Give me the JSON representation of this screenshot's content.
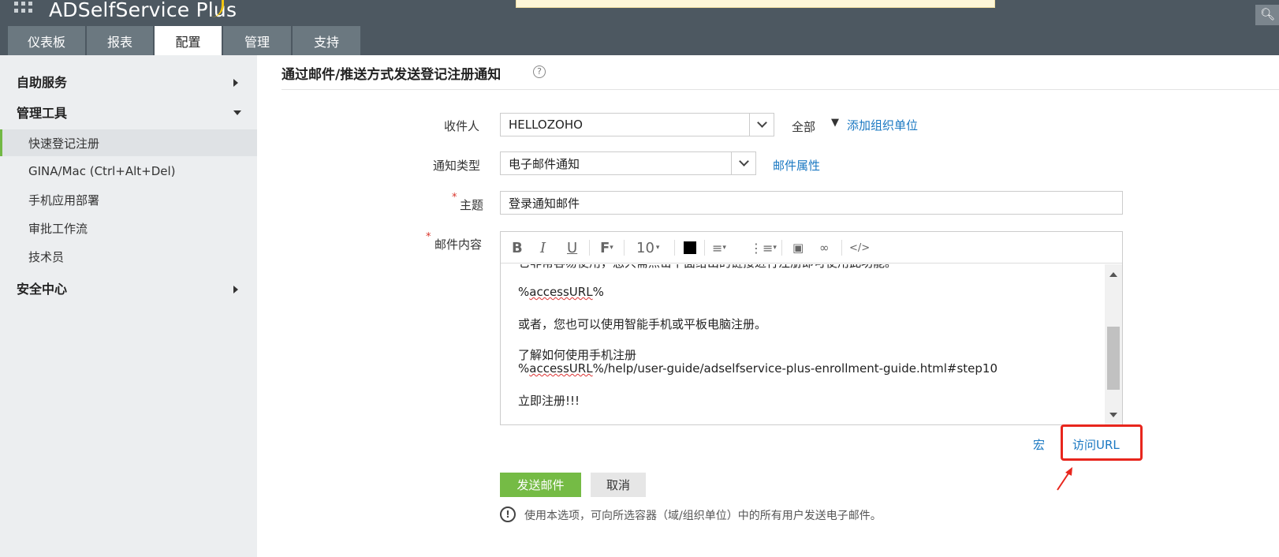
{
  "header": {
    "logo": "ADSelfService Plus",
    "tabs": [
      {
        "label": "仪表板"
      },
      {
        "label": "报表"
      },
      {
        "label": "配置"
      },
      {
        "label": "管理"
      },
      {
        "label": "支持"
      }
    ],
    "active_tab": "配置",
    "search_icon": "search-icon"
  },
  "sidebar": {
    "sections": [
      {
        "label": "自助服务",
        "expanded": false
      },
      {
        "label": "管理工具",
        "expanded": true
      },
      {
        "label": "安全中心",
        "expanded": false
      }
    ],
    "items": [
      {
        "label": "快速登记注册",
        "active": true
      },
      {
        "label": "GINA/Mac (Ctrl+Alt+Del)"
      },
      {
        "label": "手机应用部署"
      },
      {
        "label": "审批工作流"
      },
      {
        "label": "技术员"
      }
    ]
  },
  "main": {
    "title": "通过邮件/推送方式发送登记注册通知",
    "form": {
      "recipient_label": "收件人",
      "recipient_value": "HELLOZOHO",
      "scope_text": "全部",
      "add_ou_link": "添加组织单位",
      "type_label": "通知类型",
      "type_value": "电子邮件通知",
      "mail_props_link": "邮件属性",
      "subject_label": "主题",
      "subject_value": "登录通知邮件",
      "content_label": "邮件内容",
      "required_mark": "*"
    },
    "editor": {
      "font_size": "10",
      "text_color": "#000000",
      "lines": {
        "line1": "它非常容易使用，您只需点击下面给出的链接进行注册即可使用此功能。",
        "line2_var": "accessURL",
        "line3": "或者，您也可以使用智能手机或平板电脑注册。",
        "line4": "了解如何使用手机注册",
        "line5_var": "accessURL",
        "line5_rest": "%/help/user-guide/adselfservice-plus-enrollment-guide.html#step10",
        "line6": "立即注册!!!"
      }
    },
    "macro_link": "宏",
    "access_url_link": "访问URL",
    "send_button": "发送邮件",
    "cancel_button": "取消",
    "info_text": "使用本选项，可向所选容器（域/组织单位）中的所有用户发送电子邮件。"
  },
  "colors": {
    "header_bg": "#4d5861",
    "tab_bg": "#6b7880",
    "link": "#1a78c2",
    "primary": "#75bb45",
    "highlight": "#e8261d"
  }
}
